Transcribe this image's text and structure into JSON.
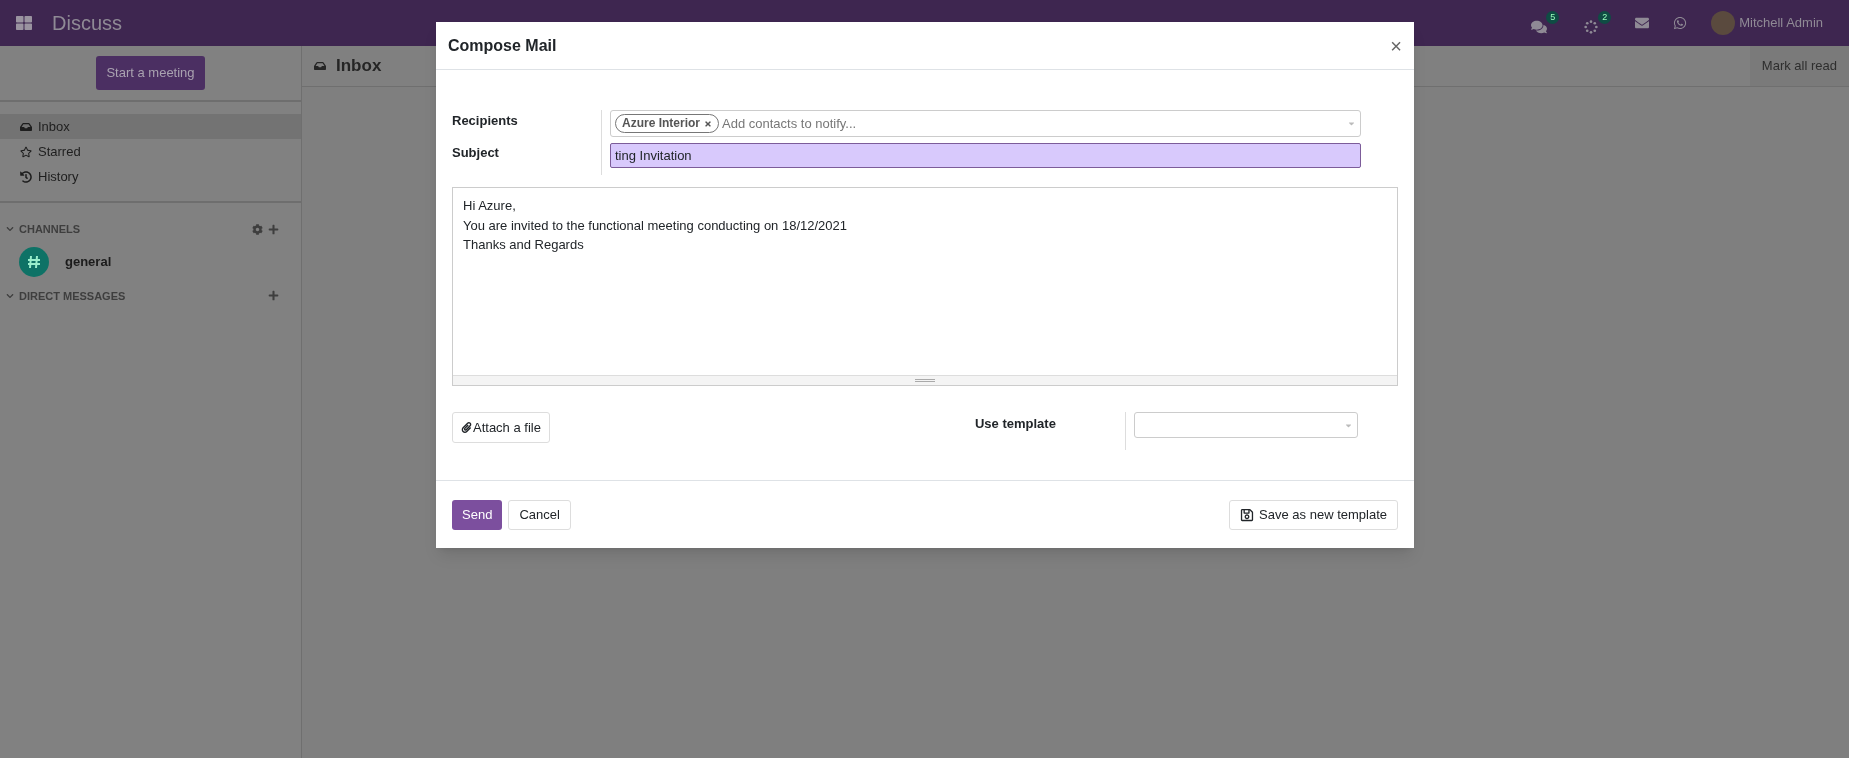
{
  "topbar": {
    "app_name": "Discuss",
    "messages_badge": "5",
    "activities_badge": "2",
    "user": "Mitchell Admin"
  },
  "sidebar": {
    "start_button": "Start a meeting",
    "items": [
      {
        "kind": "inbox",
        "label": "Inbox",
        "selected": true
      },
      {
        "kind": "starred",
        "label": "Starred",
        "selected": false
      },
      {
        "kind": "history",
        "label": "History",
        "selected": false
      }
    ],
    "channels_header": "CHANNELS",
    "channels": [
      {
        "name": "general"
      }
    ],
    "direct_messages_header": "DIRECT MESSAGES"
  },
  "main": {
    "title": "Inbox",
    "mark_all_read": "Mark all read"
  },
  "dialog": {
    "title": "Compose Mail",
    "close": "×",
    "recipients_label": "Recipients",
    "recipient_tags": [
      "Azure Interior"
    ],
    "recipients_placeholder": "Add contacts to notify...",
    "subject_label": "Subject",
    "subject_value": "ting Invitation",
    "body_lines": [
      "Hi Azure,",
      "You are invited to the functional meeting conducting on 18/12/2021",
      "Thanks and Regards"
    ],
    "attach_button": "Attach a file",
    "template_label": "Use template",
    "send_button": "Send",
    "cancel_button": "Cancel",
    "save_template_button": "Save as new template"
  }
}
